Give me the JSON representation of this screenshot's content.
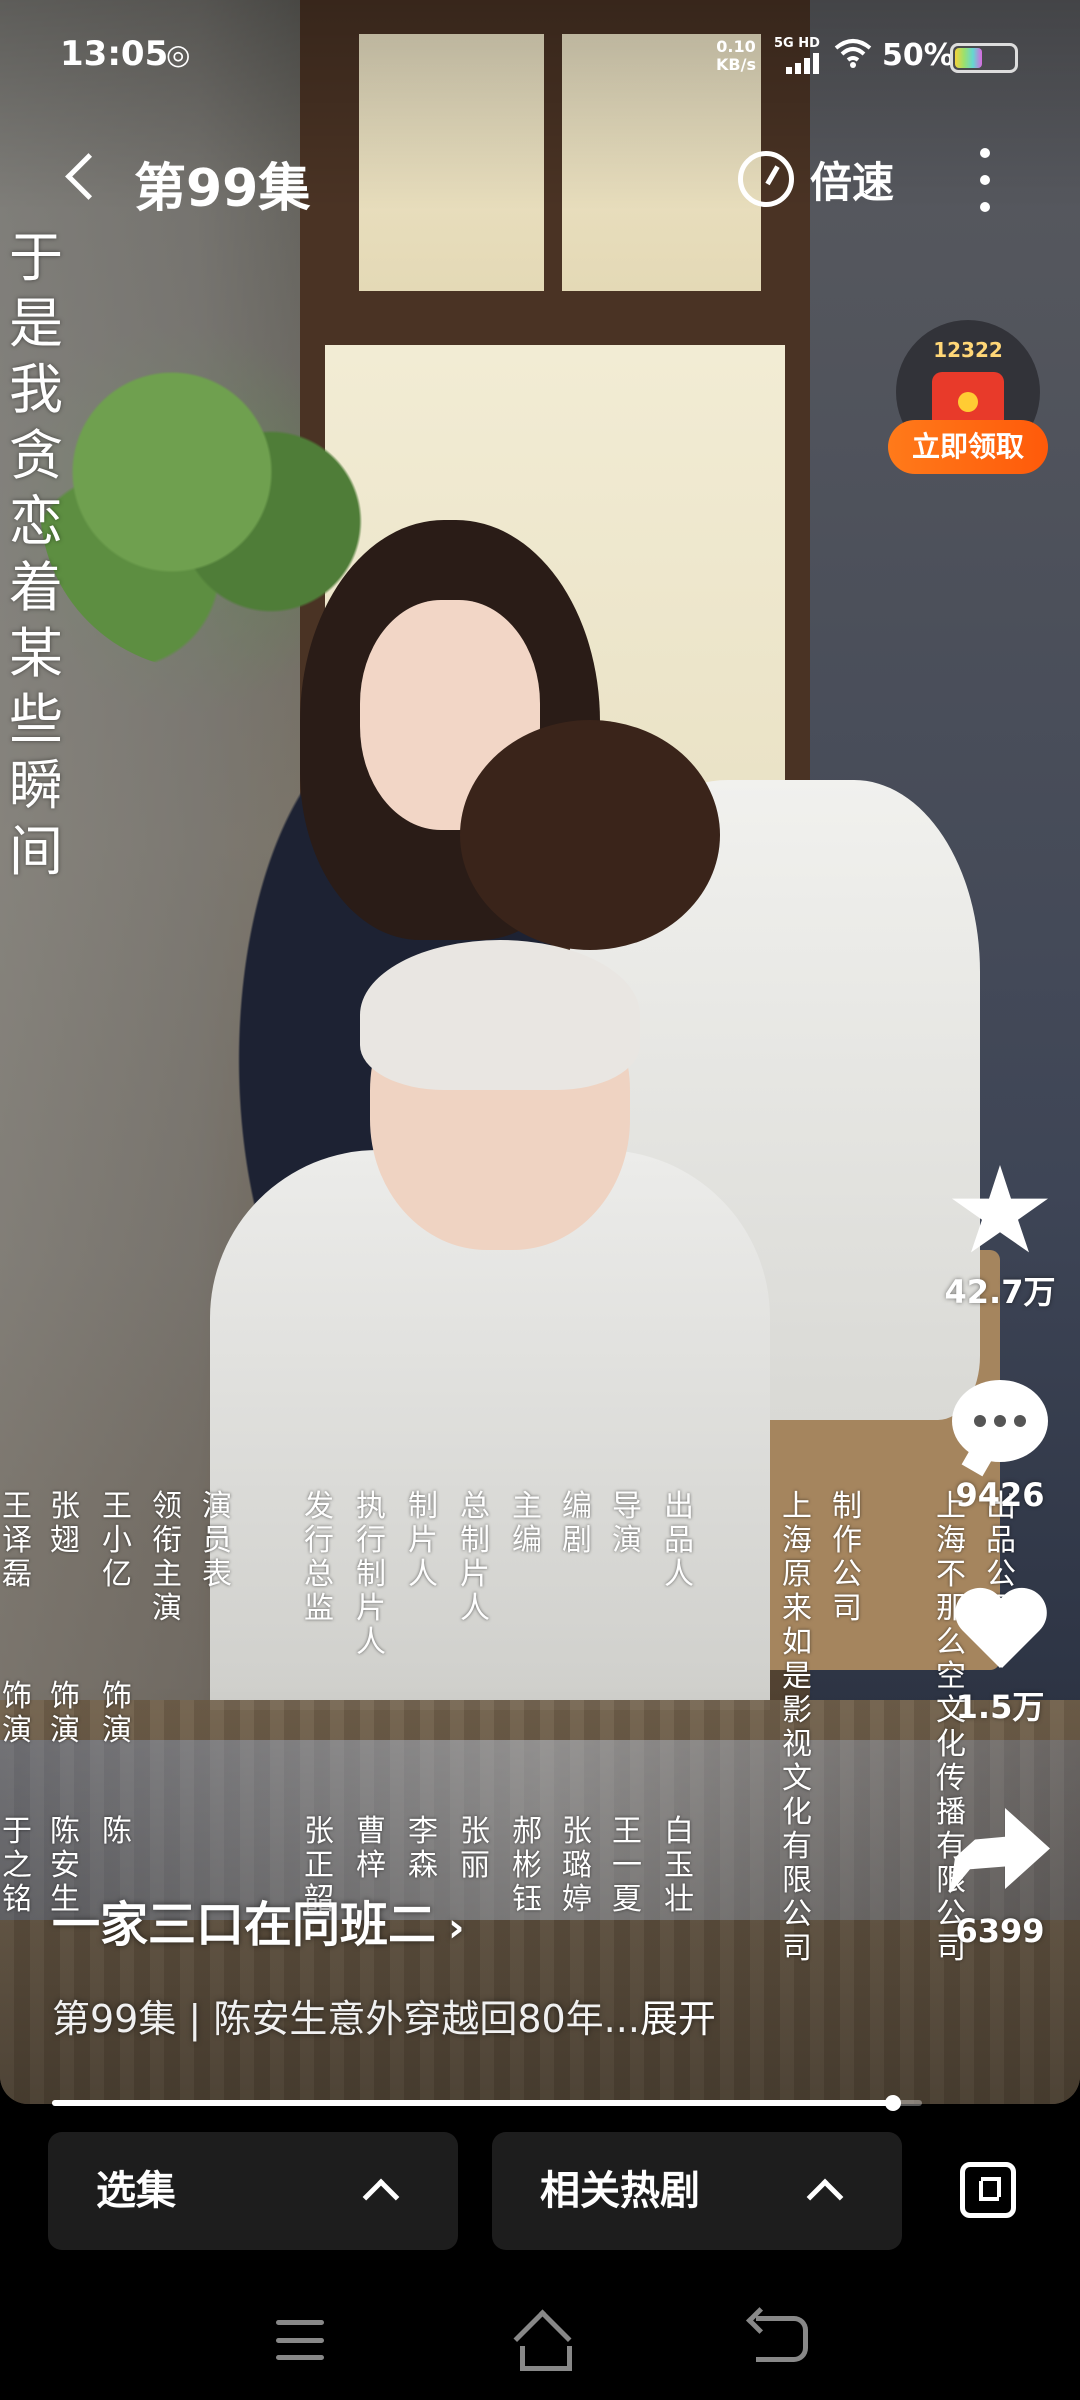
{
  "status_bar": {
    "time": "13:05",
    "network_speed_value": "0.10",
    "network_speed_unit": "KB/s",
    "signal_label": "5G HD",
    "battery_percent": "50%",
    "battery_level": 0.5
  },
  "top_bar": {
    "episode_title": "第99集",
    "speed_label": "倍速"
  },
  "lyric_text": "于是我贪恋着某些瞬间",
  "red_packet": {
    "count": "12322",
    "claim_label": "立即领取"
  },
  "actions": {
    "favorite_count": "42.7万",
    "comment_count": "9426",
    "like_count": "1.5万",
    "share_count": "6399"
  },
  "credits": {
    "cast": [
      {
        "actor": "王译磊",
        "role_prefix": "饰演",
        "role": "于之铭"
      },
      {
        "actor": "张翅",
        "role_prefix": "饰演",
        "role": "陈安生"
      },
      {
        "actor": "王小亿",
        "role_prefix": "饰演",
        "role": "陈"
      }
    ],
    "cast_header_1": "领衔主演",
    "cast_header_2": "演员表",
    "crew": [
      {
        "title": "发行总监",
        "name": "张正韶"
      },
      {
        "title": "执行制片人",
        "name": "曹梓"
      },
      {
        "title": "制片人",
        "name": "李森"
      },
      {
        "title": "总制片人",
        "name": "张丽"
      },
      {
        "title": "主编",
        "name": "郝彬钰"
      },
      {
        "title": "编剧",
        "name": "张璐婷"
      },
      {
        "title": "导演",
        "name": "王一夏"
      },
      {
        "title": "出品人",
        "name": "白玉壮"
      }
    ],
    "company_1_label": "制作公司",
    "company_1_name": "上海原来如是影视文化有限公司",
    "company_2_label": "出品公司",
    "company_2_name": "上海不那么空文化传播有限公司"
  },
  "show": {
    "title": "一家三口在同班二",
    "description": "第99集 | 陈安生意外穿越回80年...",
    "expand_label": "展开"
  },
  "progress": {
    "fraction": 0.967
  },
  "bottom_bar": {
    "episodes_label": "选集",
    "related_label": "相关热剧"
  }
}
